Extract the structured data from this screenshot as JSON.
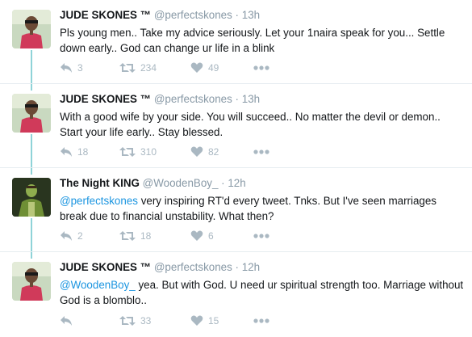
{
  "tweets": [
    {
      "name": "JUDE SKONES ™",
      "handle": "@perfectskones",
      "time": "13h",
      "text": "Pls young men..  Take my advice seriously.  Let your 1naira speak for you... Settle down early..  God can change ur life in a blink",
      "replies": "3",
      "retweets": "234",
      "likes": "49",
      "avatar_icon": "profile-photo-man-red-shirt"
    },
    {
      "name": "JUDE SKONES ™",
      "handle": "@perfectskones",
      "time": "13h",
      "text": "With a good wife by your side.   You will succeed.. No matter the devil or demon..  Start your life early..  Stay blessed.",
      "replies": "18",
      "retweets": "310",
      "likes": "82",
      "avatar_icon": "profile-photo-man-red-shirt"
    },
    {
      "name": "The Night KING",
      "handle": "@WoodenBoy_",
      "time": "12h",
      "mention": "@perfectskones",
      "text": " very inspiring RT'd every tweet. Tnks. But I've seen marriages break due to financial unstability. What then?",
      "replies": "2",
      "retweets": "18",
      "likes": "6",
      "avatar_icon": "profile-photo-green-figure"
    },
    {
      "name": "JUDE SKONES ™",
      "handle": "@perfectskones",
      "time": "12h",
      "mention": "@WoodenBoy_",
      "text": " yea.  But with God.  U need ur spiritual strength too.   Marriage without God is a blomblo..",
      "replies": "",
      "retweets": "33",
      "likes": "15",
      "avatar_icon": "profile-photo-man-red-shirt"
    }
  ],
  "separator_dot": "·",
  "icons": {
    "reply": "reply-arrow-icon",
    "retweet": "retweet-icon",
    "like": "heart-icon",
    "more": "more-dots-icon"
  },
  "colors": {
    "thread_line": "#8fd3d8",
    "mention": "#1b95e0",
    "muted": "#8899a6",
    "action": "#aab8c2"
  }
}
